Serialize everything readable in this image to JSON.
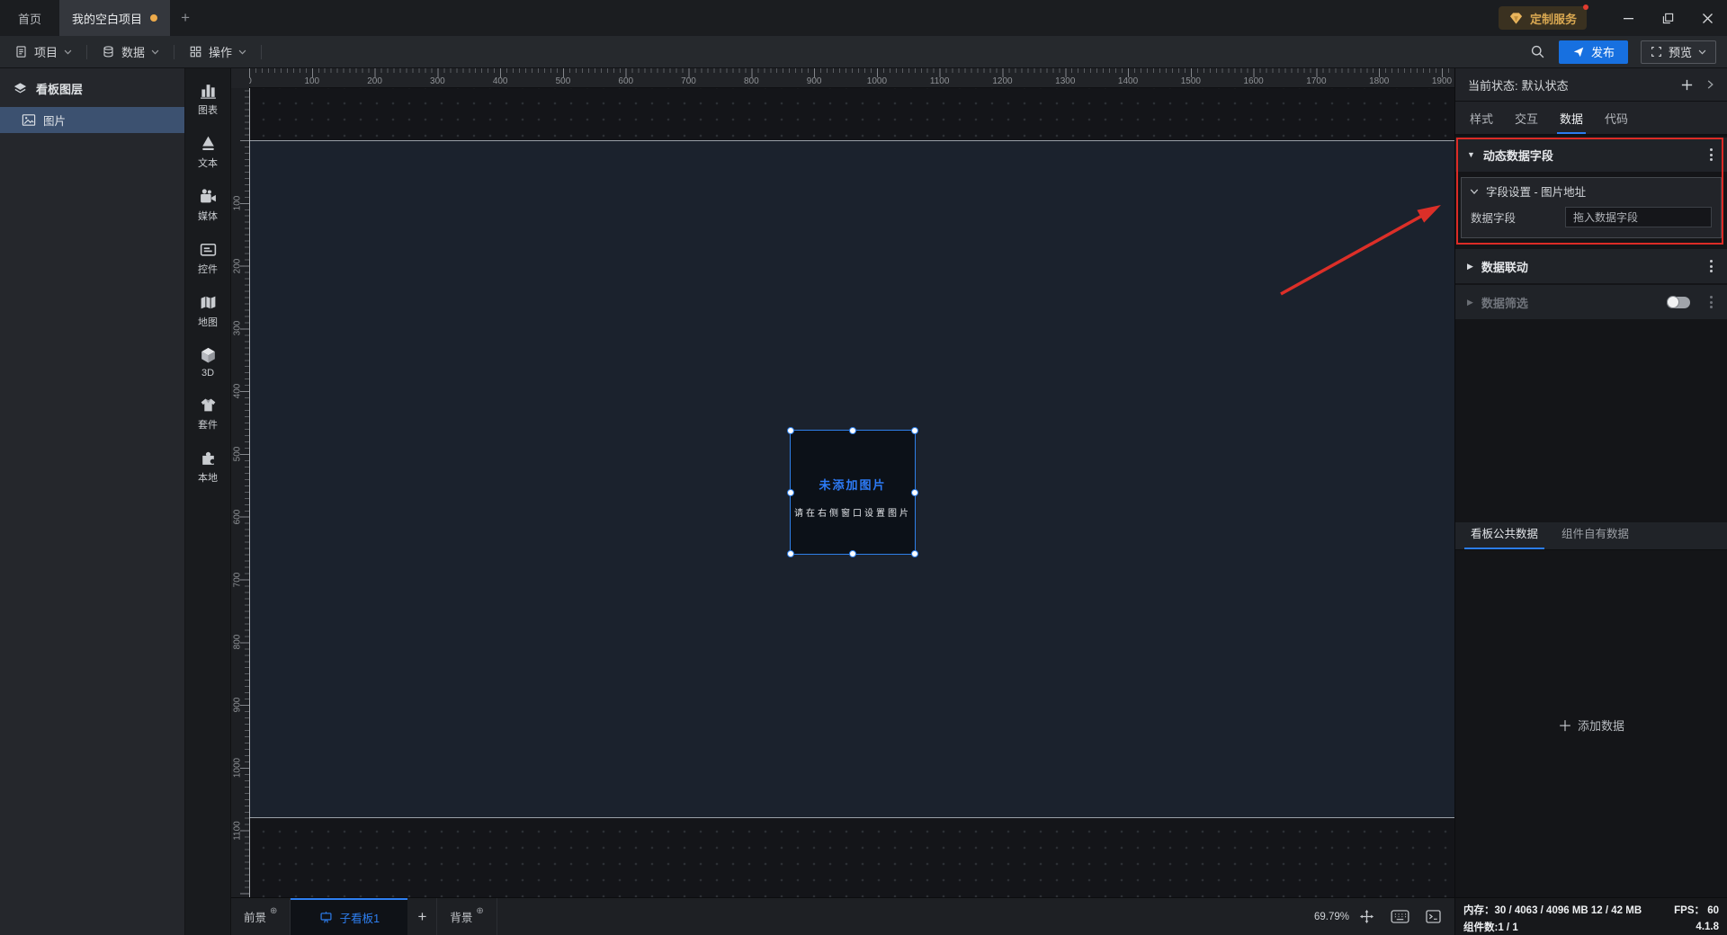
{
  "window": {
    "home_tab": "首页",
    "project_tab": "我的空白项目",
    "new_tab": "+",
    "service_badge": "定制服务"
  },
  "menubar": {
    "project": "项目",
    "data": "数据",
    "action": "操作",
    "publish": "发布",
    "preview": "预览"
  },
  "layers": {
    "title": "看板图层",
    "items": [
      {
        "label": "图片"
      }
    ]
  },
  "palette": {
    "items": [
      "图表",
      "文本",
      "媒体",
      "控件",
      "地图",
      "3D",
      "套件",
      "本地"
    ]
  },
  "canvas": {
    "h_ruler": [
      "0",
      "100",
      "200",
      "300",
      "400",
      "500",
      "600",
      "700",
      "800",
      "900",
      "1000",
      "1100",
      "1200",
      "1300",
      "1400",
      "1500",
      "1600",
      "1700",
      "1800",
      "1900"
    ],
    "v_ruler": [
      "100",
      "200",
      "300",
      "400",
      "500",
      "600",
      "700",
      "800",
      "900",
      "1000",
      "1100"
    ],
    "component": {
      "title": "未添加图片",
      "subtitle": "请在右侧窗口设置图片"
    }
  },
  "inspector": {
    "state_label": "当前状态:",
    "state_value": "默认状态",
    "tabs": [
      "样式",
      "交互",
      "数据",
      "代码"
    ],
    "dynamic_fields": "动态数据字段",
    "field_settings": "字段设置 - 图片地址",
    "field_label": "数据字段",
    "field_placeholder": "拖入数据字段",
    "data_linkage": "数据联动",
    "data_filter": "数据筛选",
    "data_tabs": [
      "看板公共数据",
      "组件自有数据"
    ],
    "add_data": "添加数据"
  },
  "statusbar": {
    "foreground": "前景",
    "board_tab": "子看板1",
    "add": "+",
    "background": "背景",
    "zoom": "69.79%"
  },
  "info": {
    "memory_label": "内存：",
    "memory_value": "30 / 4063 / 4096 MB  12 / 42 MB",
    "fps_label": "FPS：",
    "fps_value": "60",
    "components_label": "组件数:",
    "components_value": "1 / 1",
    "version": "4.1.8"
  },
  "colors": {
    "accent": "#2b7cf0",
    "danger": "#dc2b26",
    "warning": "#edaa4b"
  }
}
